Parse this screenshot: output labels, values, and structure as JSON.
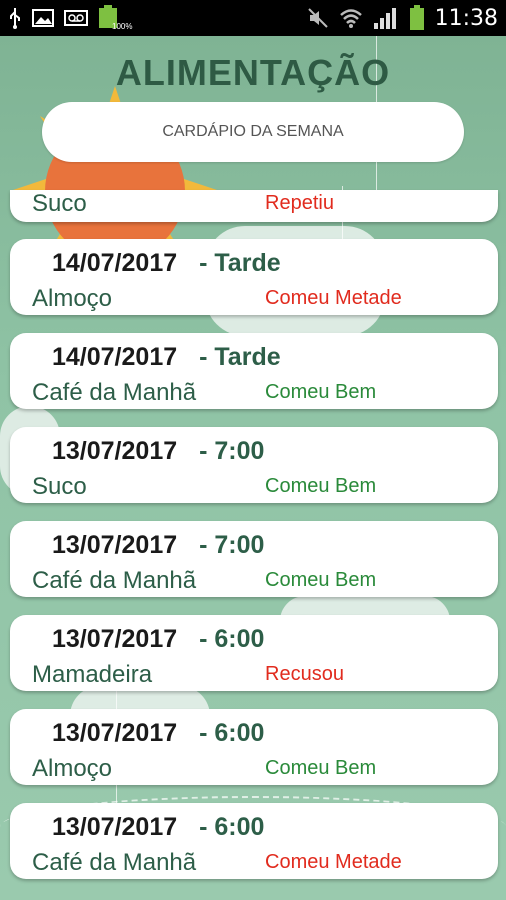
{
  "status_bar": {
    "time": "11:38",
    "battery_percent": "100%",
    "icons_left": [
      "usb-icon",
      "image-icon",
      "voicemail-icon",
      "battery-charging-icon"
    ],
    "icons_right": [
      "mute-icon",
      "wifi-icon",
      "signal-icon",
      "battery-icon"
    ]
  },
  "header": {
    "title": "ALIMENTAÇÃO",
    "menu_button": "CARDÁPIO DA SEMANA"
  },
  "partial_entry": {
    "meal": "Suco",
    "status": "Repetiu",
    "status_type": "bad"
  },
  "entries": [
    {
      "date": "14/07/2017",
      "period": "- Tarde",
      "meal": "Almoço",
      "status": "Comeu Metade",
      "status_type": "bad"
    },
    {
      "date": "14/07/2017",
      "period": "- Tarde",
      "meal": "Café da Manhã",
      "status": "Comeu Bem",
      "status_type": "ok"
    },
    {
      "date": "13/07/2017",
      "period": "- 7:00",
      "meal": "Suco",
      "status": "Comeu Bem",
      "status_type": "ok"
    },
    {
      "date": "13/07/2017",
      "period": "- 7:00",
      "meal": "Café da Manhã",
      "status": "Comeu Bem",
      "status_type": "ok"
    },
    {
      "date": "13/07/2017",
      "period": "- 6:00",
      "meal": "Mamadeira",
      "status": "Recusou",
      "status_type": "bad"
    },
    {
      "date": "13/07/2017",
      "period": "- 6:00",
      "meal": "Almoço",
      "status": "Comeu Bem",
      "status_type": "ok"
    },
    {
      "date": "13/07/2017",
      "period": "- 6:00",
      "meal": "Café da Manhã",
      "status": "Comeu Metade",
      "status_type": "bad"
    }
  ],
  "colors": {
    "background": "#8fbfa2",
    "title": "#2e5a44",
    "status_ok": "#2a8a3a",
    "status_bad": "#e12b1e",
    "sun": "#e8733c",
    "sun_rays": "#f2b93b"
  }
}
